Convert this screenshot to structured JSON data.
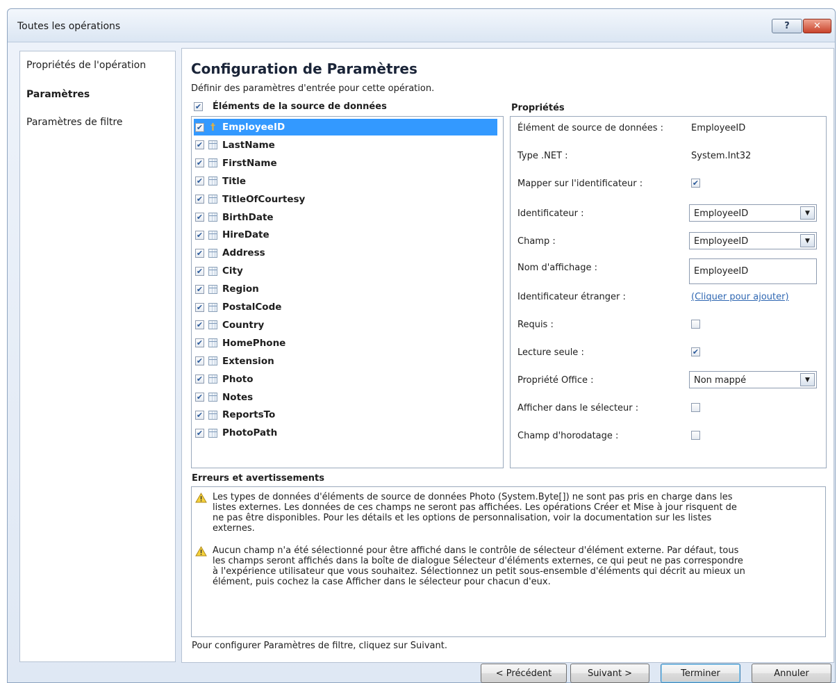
{
  "window": {
    "title": "Toutes les opérations",
    "help_label": "?",
    "close_label": "✕"
  },
  "nav": {
    "items": [
      {
        "label": "Propriétés de l'opération",
        "active": false
      },
      {
        "label": "Paramètres",
        "active": true
      },
      {
        "label": "Paramètres de filtre",
        "active": false
      }
    ]
  },
  "main": {
    "title": "Configuration de Paramètres",
    "subtitle": "Définir des paramètres d'entrée pour cette opération.",
    "source_header": "Éléments de la source de données",
    "source_header_checked": true,
    "properties_header": "Propriétés",
    "errors_header": "Erreurs et avertissements",
    "footer_hint": "Pour configurer Paramètres de filtre, cliquez sur Suivant."
  },
  "fields": [
    {
      "name": "EmployeeID",
      "checked": true,
      "icon": "key-icon",
      "selected": true
    },
    {
      "name": "LastName",
      "checked": true,
      "icon": "table-icon"
    },
    {
      "name": "FirstName",
      "checked": true,
      "icon": "table-icon"
    },
    {
      "name": "Title",
      "checked": true,
      "icon": "table-icon"
    },
    {
      "name": "TitleOfCourtesy",
      "checked": true,
      "icon": "table-icon"
    },
    {
      "name": "BirthDate",
      "checked": true,
      "icon": "table-icon"
    },
    {
      "name": "HireDate",
      "checked": true,
      "icon": "table-icon"
    },
    {
      "name": "Address",
      "checked": true,
      "icon": "table-icon"
    },
    {
      "name": "City",
      "checked": true,
      "icon": "table-icon"
    },
    {
      "name": "Region",
      "checked": true,
      "icon": "table-icon"
    },
    {
      "name": "PostalCode",
      "checked": true,
      "icon": "table-icon"
    },
    {
      "name": "Country",
      "checked": true,
      "icon": "table-icon"
    },
    {
      "name": "HomePhone",
      "checked": true,
      "icon": "table-icon"
    },
    {
      "name": "Extension",
      "checked": true,
      "icon": "table-icon"
    },
    {
      "name": "Photo",
      "checked": true,
      "icon": "table-icon"
    },
    {
      "name": "Notes",
      "checked": true,
      "icon": "table-icon"
    },
    {
      "name": "ReportsTo",
      "checked": true,
      "icon": "table-icon"
    },
    {
      "name": "PhotoPath",
      "checked": true,
      "icon": "table-icon"
    }
  ],
  "properties": {
    "data_source_element": {
      "label": "Élément de source de données :",
      "value": "EmployeeID"
    },
    "net_type": {
      "label": "Type .NET :",
      "value": "System.Int32"
    },
    "map_to_identifier": {
      "label": "Mapper sur l'identificateur :",
      "checked": true
    },
    "identifier": {
      "label": "Identificateur :",
      "value": "EmployeeID"
    },
    "field": {
      "label": "Champ :",
      "value": "EmployeeID"
    },
    "display_name": {
      "label": "Nom d'affichage :",
      "value": "EmployeeID"
    },
    "foreign_identifier": {
      "label": "Identificateur étranger :",
      "link": "(Cliquer pour ajouter)"
    },
    "required": {
      "label": "Requis :",
      "checked": false
    },
    "read_only": {
      "label": "Lecture seule :",
      "checked": true
    },
    "office_property": {
      "label": "Propriété Office :",
      "value": "Non mappé"
    },
    "show_in_picker": {
      "label": "Afficher dans le sélecteur :",
      "checked": false
    },
    "timestamp_field": {
      "label": "Champ d'horodatage :",
      "checked": false
    }
  },
  "errors": [
    {
      "icon": "warning-icon",
      "lines": [
        "Les types de données d'éléments de source de données Photo (System.Byte[]) ne sont pas pris en charge dans les",
        "listes externes. Les données de ces champs ne seront pas affichées. Les opérations Créer et Mise à jour risquent de",
        "ne pas être disponibles. Pour les détails et les  options de personnalisation, voir la documentation sur les listes",
        "externes."
      ]
    },
    {
      "icon": "warning-icon",
      "lines": [
        "Aucun champ n'a été sélectionné pour être affiché dans le contrôle de sélecteur d'élément externe. Par défaut, tous",
        "les champs seront affichés dans la boîte de dialogue Sélecteur d'éléments externes, ce qui peut ne pas correspondre",
        "à l'expérience utilisateur que vous souhaitez. Sélectionnez un petit sous-ensemble d'éléments qui décrit au mieux un",
        "élément, puis cochez la case Afficher dans le sélecteur pour chacun d'eux."
      ]
    }
  ],
  "buttons": {
    "previous": "< Précédent",
    "next": "Suivant >",
    "finish": "Terminer",
    "cancel": "Annuler"
  },
  "colors": {
    "selection": "#3399ff",
    "link": "#2f67b2",
    "close_button": "#c8432b"
  }
}
